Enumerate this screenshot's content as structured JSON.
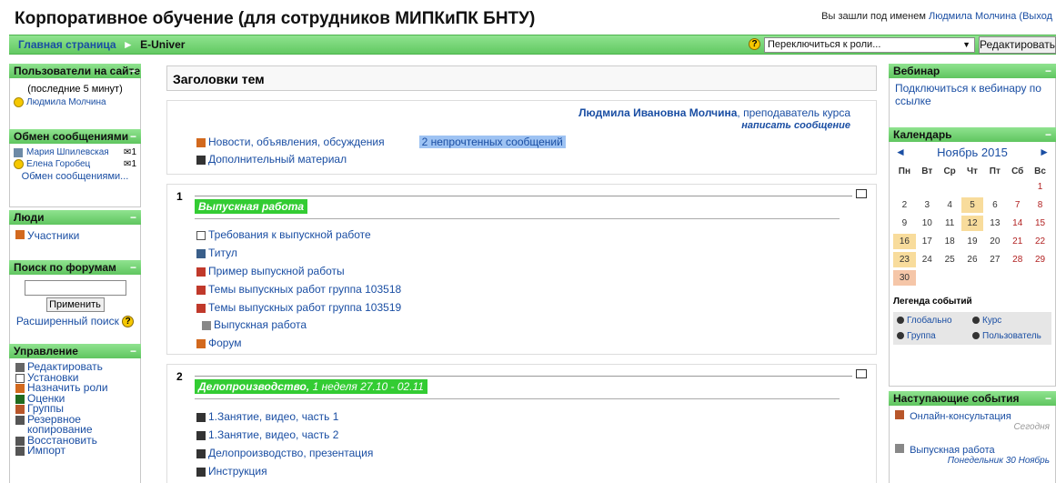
{
  "header": {
    "site_title": "Корпоративное обучение (для сотрудников МИПКиПК БНТУ)",
    "login_prefix": "Вы зашли под именем",
    "login_user": "Людмила Молчина",
    "logout": "(Выход"
  },
  "navbar": {
    "home": "Главная страница",
    "separator": "►",
    "current": "E-Univer",
    "role_select_value": "Переключиться к роли...",
    "edit_button": "Редактировать"
  },
  "left": {
    "online": {
      "title": "Пользователи на сайте",
      "subtitle": "(последние 5 минут)",
      "users": [
        "Людмила Молчина"
      ]
    },
    "messages": {
      "title": "Обмен сообщениями",
      "items": [
        {
          "name": "Мария Шпилевская",
          "count": "1"
        },
        {
          "name": "Елена Горобец",
          "count": "1"
        }
      ],
      "link": "Обмен сообщениями..."
    },
    "people": {
      "title": "Люди",
      "participants": "Участники"
    },
    "search": {
      "title": "Поиск по форумам",
      "apply_button": "Применить",
      "advanced": "Расширенный поиск"
    },
    "admin": {
      "title": "Управление",
      "items": [
        "Редактировать",
        "Установки",
        "Назначить роли",
        "Оценки",
        "Группы",
        "Резервное копирование",
        "Восстановить",
        "Импорт"
      ]
    }
  },
  "center": {
    "header": "Заголовки тем",
    "section0": {
      "teacher_name": "Людмила Ивановна Молчина",
      "teacher_role": ", преподаватель курса",
      "write_message": "написать сообщение",
      "news": "Новости, объявления, обсуждения",
      "unread": "2 непрочтенных сообщений",
      "extra": "Дополнительный материал"
    },
    "section1": {
      "num": "1",
      "title": "Выпускная работа",
      "items": [
        "Требования к выпускной работе",
        "Титул",
        "Пример выпускной работы",
        "Темы выпускных работ группа 103518",
        "Темы выпускных работ группа 103519",
        "Выпускная работа",
        "Форум"
      ]
    },
    "section2": {
      "num": "2",
      "title_bold": "Делопроизводство,",
      "title_rest": " 1 неделя 27.10 - 02.11",
      "items": [
        "1.Занятие, видео, часть 1",
        "1.Занятие, видео, часть 2",
        "Делопроизводство, презентация",
        "Инструкция"
      ]
    }
  },
  "right": {
    "webinar": {
      "title": "Вебинар",
      "link": "Подключиться к вебинару по ссылке"
    },
    "calendar": {
      "title": "Календарь",
      "prev": "◄",
      "next": "►",
      "month": "Ноябрь 2015",
      "day_headers": [
        "Пн",
        "Вт",
        "Ср",
        "Чт",
        "Пт",
        "Сб",
        "Вс"
      ],
      "legend_title": "Легенда событий",
      "legend": [
        "Глобально",
        "Курс",
        "Группа",
        "Пользователь"
      ]
    },
    "upcoming": {
      "title": "Наступающие события",
      "events": [
        {
          "name": "Онлайн-консультация",
          "date": "Сегодня"
        },
        {
          "name": "Выпускная работа",
          "date": "Понедельник 30 Ноябрь"
        }
      ]
    }
  },
  "colors": {
    "accent_green": "#62c962",
    "link_blue": "#1a4ea3",
    "section_title_green": "#33cc33"
  }
}
